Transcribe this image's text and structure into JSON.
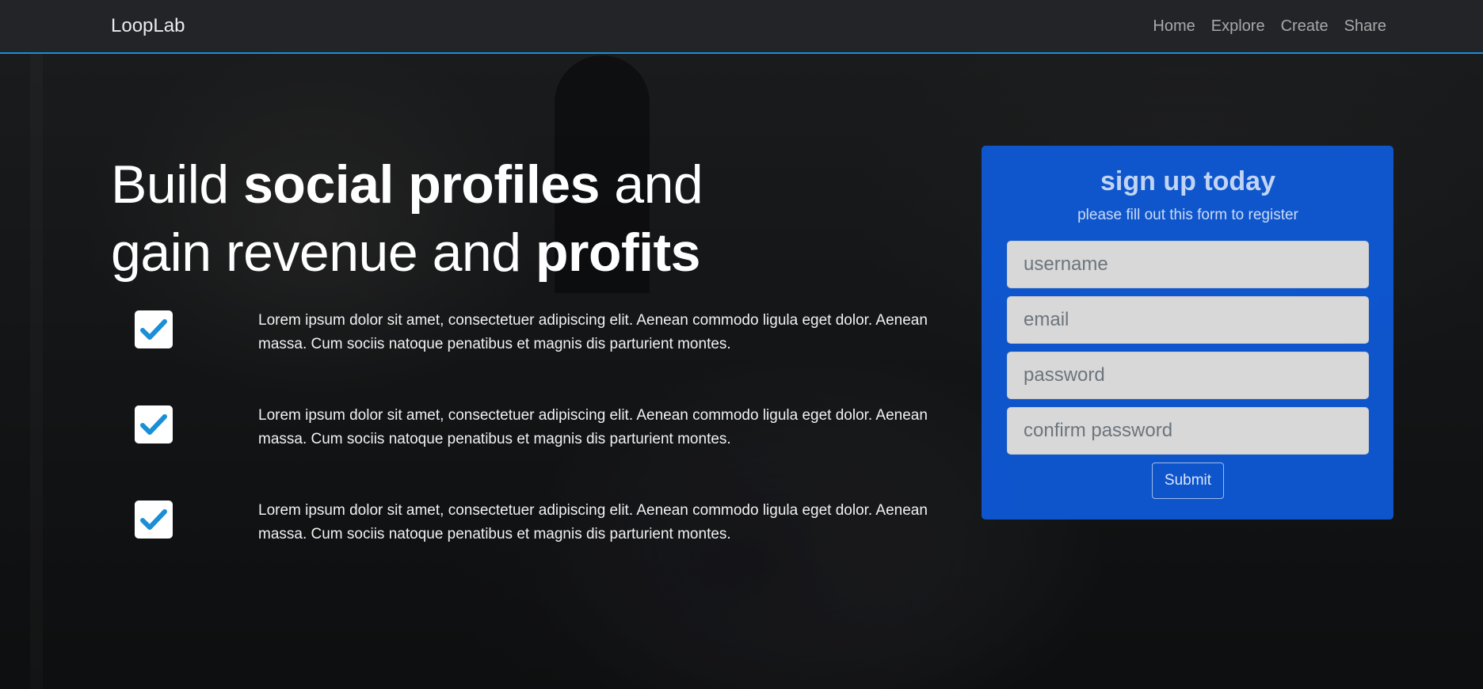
{
  "navbar": {
    "brand": "LoopLab",
    "links": [
      "Home",
      "Explore",
      "Create",
      "Share"
    ]
  },
  "hero": {
    "headline_parts": [
      "Build ",
      "social profiles",
      " and gain revenue and ",
      "profits"
    ]
  },
  "features": [
    {
      "icon": "check-icon",
      "text": "Lorem ipsum dolor sit amet, consectetuer adipiscing elit. Aenean commodo ligula eget dolor. Aenean massa. Cum sociis natoque penatibus et magnis dis parturient montes."
    },
    {
      "icon": "check-icon",
      "text": "Lorem ipsum dolor sit amet, consectetuer adipiscing elit. Aenean commodo ligula eget dolor. Aenean massa. Cum sociis natoque penatibus et magnis dis parturient montes."
    },
    {
      "icon": "check-icon",
      "text": "Lorem ipsum dolor sit amet, consectetuer adipiscing elit. Aenean commodo ligula eget dolor. Aenean massa. Cum sociis natoque penatibus et magnis dis parturient montes."
    }
  ],
  "signup": {
    "title": "sign up today",
    "subtitle": "please fill out this form to register",
    "fields": {
      "username": {
        "placeholder": "username",
        "value": ""
      },
      "email": {
        "placeholder": "email",
        "value": ""
      },
      "password": {
        "placeholder": "password",
        "value": ""
      },
      "confirm_password": {
        "placeholder": "confirm password",
        "value": ""
      }
    },
    "submit_label": "Submit"
  },
  "colors": {
    "accent": "#1a8fd6",
    "card": "#0e5fe6",
    "check": "#1a8fd6",
    "navbar": "#232629"
  }
}
